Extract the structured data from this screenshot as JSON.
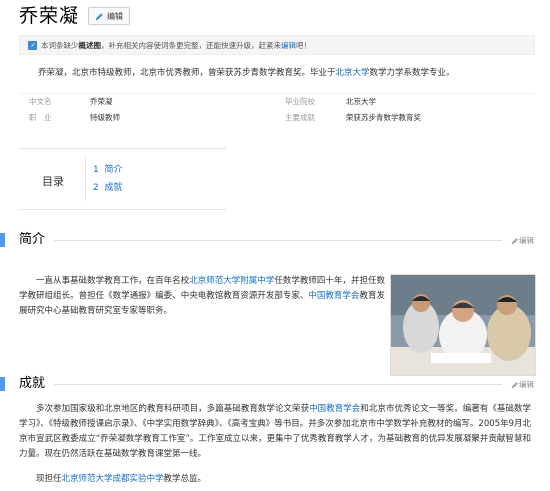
{
  "title": "乔荣凝",
  "edit_label": "编辑",
  "notice": {
    "part1": "本词条缺少",
    "bold": "概述图",
    "part2": "，补充相关内容使词条更完整，还能快速升级，赶紧来",
    "link": "编辑",
    "part3": "吧！"
  },
  "summary": {
    "text1": "乔荣凝，北京市特级教师，北京市优秀教师，曾荣获苏步青数学教育奖。毕业于",
    "link": "北京大学",
    "text2": "数学力学系数学专业。"
  },
  "basic_info": {
    "chinese_name_key": "中文名",
    "chinese_name_val": "乔荣凝",
    "school_key": "毕业院校",
    "school_val": "北京大学",
    "job_key": "职　业",
    "job_val": "特级教师",
    "achievement_key": "主要成就",
    "achievement_val": "荣获苏步青数学教育奖"
  },
  "toc": {
    "title": "目录",
    "items": [
      {
        "num": "1",
        "label": "简介"
      },
      {
        "num": "2",
        "label": "成就"
      }
    ]
  },
  "section1": {
    "title": "简介",
    "edit": "编辑",
    "p1_a": "一直从事基础数学教育工作，在百年名校",
    "p1_link1": "北京师范大学附属中学",
    "p1_b": "任数学教师四十年，并担任数学教研组组长。曾担任《数学通报》编委、中央电教馆教育资源开发部专家、",
    "p1_link2": "中国教育学会",
    "p1_c": "教育发展研究中心基础教育研究室专家等职务。"
  },
  "section2": {
    "title": "成就",
    "edit": "编辑",
    "p1_a": "多次参加国家级和北京地区的教育科研项目，多篇基础教育数学论文荣获",
    "p1_link": "中国教育学会",
    "p1_b": "和北京市优秀论文一等奖。编著有《基础数学学习》、《特级教师授课启示录》、《中学实用数学辞典》、《高考宝典》等书目。并多次参加北京市中学数学补充教材的编写。2005年9月北京市宣武区教委成立“乔荣凝数学教育工作室”。工作室成立以来，更集中了优秀教育教学人才，为基础教育的优异发展凝聚并贡献智慧和力量。现在仍然活跃在基础数学教育课堂第一线。",
    "p2_a": "现担任",
    "p2_link": "北京师范大学成都实验中学",
    "p2_b": "教学总监。"
  },
  "colors": {
    "accent": "#4f9cee",
    "link": "#136ec2"
  },
  "icons": {
    "edit": "pencil-icon",
    "notice": "info-icon"
  }
}
